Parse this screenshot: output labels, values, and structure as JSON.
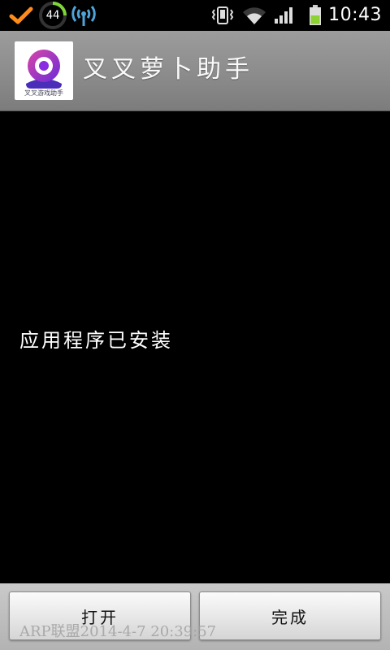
{
  "status_bar": {
    "notification_count": "44",
    "time": "10:43",
    "icons": [
      "check-icon",
      "usb-tethering-icon",
      "vibrate-icon",
      "wifi-icon",
      "signal-icon",
      "battery-icon"
    ],
    "accent_color": "#ff8c1a",
    "battery_color": "#8bd232"
  },
  "app": {
    "name": "叉叉萝卜助手",
    "icon_caption": "叉叉游戏助手",
    "icon_color": "#8a2be2"
  },
  "content": {
    "message": "应用程序已安装"
  },
  "buttons": {
    "open_label": "打开",
    "done_label": "完成"
  },
  "watermark": {
    "text": "ARP联盟2014-4-7 20:39:57"
  }
}
